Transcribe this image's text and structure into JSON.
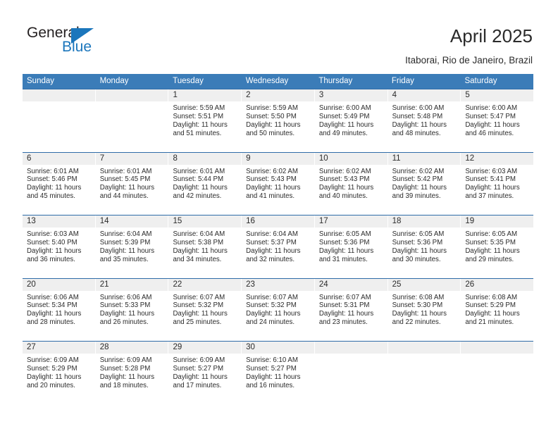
{
  "logo": {
    "word_top": "General",
    "word_bottom": "Blue",
    "accent_color": "#1b76bc"
  },
  "header": {
    "title": "April 2025",
    "location": "Itaborai, Rio de Janeiro, Brazil"
  },
  "theme": {
    "header_blue": "#3b7cb8",
    "row_divider": "#2f6ca8",
    "daynum_band": "#efefef",
    "text": "#2b2b2b"
  },
  "calendar": {
    "weekday_headers": [
      "Sunday",
      "Monday",
      "Tuesday",
      "Wednesday",
      "Thursday",
      "Friday",
      "Saturday"
    ],
    "weeks": [
      [
        {
          "day": "",
          "sunrise": "",
          "sunset": "",
          "daylight_line1": "",
          "daylight_line2": ""
        },
        {
          "day": "",
          "sunrise": "",
          "sunset": "",
          "daylight_line1": "",
          "daylight_line2": ""
        },
        {
          "day": "1",
          "sunrise": "Sunrise: 5:59 AM",
          "sunset": "Sunset: 5:51 PM",
          "daylight_line1": "Daylight: 11 hours",
          "daylight_line2": "and 51 minutes."
        },
        {
          "day": "2",
          "sunrise": "Sunrise: 5:59 AM",
          "sunset": "Sunset: 5:50 PM",
          "daylight_line1": "Daylight: 11 hours",
          "daylight_line2": "and 50 minutes."
        },
        {
          "day": "3",
          "sunrise": "Sunrise: 6:00 AM",
          "sunset": "Sunset: 5:49 PM",
          "daylight_line1": "Daylight: 11 hours",
          "daylight_line2": "and 49 minutes."
        },
        {
          "day": "4",
          "sunrise": "Sunrise: 6:00 AM",
          "sunset": "Sunset: 5:48 PM",
          "daylight_line1": "Daylight: 11 hours",
          "daylight_line2": "and 48 minutes."
        },
        {
          "day": "5",
          "sunrise": "Sunrise: 6:00 AM",
          "sunset": "Sunset: 5:47 PM",
          "daylight_line1": "Daylight: 11 hours",
          "daylight_line2": "and 46 minutes."
        }
      ],
      [
        {
          "day": "6",
          "sunrise": "Sunrise: 6:01 AM",
          "sunset": "Sunset: 5:46 PM",
          "daylight_line1": "Daylight: 11 hours",
          "daylight_line2": "and 45 minutes."
        },
        {
          "day": "7",
          "sunrise": "Sunrise: 6:01 AM",
          "sunset": "Sunset: 5:45 PM",
          "daylight_line1": "Daylight: 11 hours",
          "daylight_line2": "and 44 minutes."
        },
        {
          "day": "8",
          "sunrise": "Sunrise: 6:01 AM",
          "sunset": "Sunset: 5:44 PM",
          "daylight_line1": "Daylight: 11 hours",
          "daylight_line2": "and 42 minutes."
        },
        {
          "day": "9",
          "sunrise": "Sunrise: 6:02 AM",
          "sunset": "Sunset: 5:43 PM",
          "daylight_line1": "Daylight: 11 hours",
          "daylight_line2": "and 41 minutes."
        },
        {
          "day": "10",
          "sunrise": "Sunrise: 6:02 AM",
          "sunset": "Sunset: 5:43 PM",
          "daylight_line1": "Daylight: 11 hours",
          "daylight_line2": "and 40 minutes."
        },
        {
          "day": "11",
          "sunrise": "Sunrise: 6:02 AM",
          "sunset": "Sunset: 5:42 PM",
          "daylight_line1": "Daylight: 11 hours",
          "daylight_line2": "and 39 minutes."
        },
        {
          "day": "12",
          "sunrise": "Sunrise: 6:03 AM",
          "sunset": "Sunset: 5:41 PM",
          "daylight_line1": "Daylight: 11 hours",
          "daylight_line2": "and 37 minutes."
        }
      ],
      [
        {
          "day": "13",
          "sunrise": "Sunrise: 6:03 AM",
          "sunset": "Sunset: 5:40 PM",
          "daylight_line1": "Daylight: 11 hours",
          "daylight_line2": "and 36 minutes."
        },
        {
          "day": "14",
          "sunrise": "Sunrise: 6:04 AM",
          "sunset": "Sunset: 5:39 PM",
          "daylight_line1": "Daylight: 11 hours",
          "daylight_line2": "and 35 minutes."
        },
        {
          "day": "15",
          "sunrise": "Sunrise: 6:04 AM",
          "sunset": "Sunset: 5:38 PM",
          "daylight_line1": "Daylight: 11 hours",
          "daylight_line2": "and 34 minutes."
        },
        {
          "day": "16",
          "sunrise": "Sunrise: 6:04 AM",
          "sunset": "Sunset: 5:37 PM",
          "daylight_line1": "Daylight: 11 hours",
          "daylight_line2": "and 32 minutes."
        },
        {
          "day": "17",
          "sunrise": "Sunrise: 6:05 AM",
          "sunset": "Sunset: 5:36 PM",
          "daylight_line1": "Daylight: 11 hours",
          "daylight_line2": "and 31 minutes."
        },
        {
          "day": "18",
          "sunrise": "Sunrise: 6:05 AM",
          "sunset": "Sunset: 5:36 PM",
          "daylight_line1": "Daylight: 11 hours",
          "daylight_line2": "and 30 minutes."
        },
        {
          "day": "19",
          "sunrise": "Sunrise: 6:05 AM",
          "sunset": "Sunset: 5:35 PM",
          "daylight_line1": "Daylight: 11 hours",
          "daylight_line2": "and 29 minutes."
        }
      ],
      [
        {
          "day": "20",
          "sunrise": "Sunrise: 6:06 AM",
          "sunset": "Sunset: 5:34 PM",
          "daylight_line1": "Daylight: 11 hours",
          "daylight_line2": "and 28 minutes."
        },
        {
          "day": "21",
          "sunrise": "Sunrise: 6:06 AM",
          "sunset": "Sunset: 5:33 PM",
          "daylight_line1": "Daylight: 11 hours",
          "daylight_line2": "and 26 minutes."
        },
        {
          "day": "22",
          "sunrise": "Sunrise: 6:07 AM",
          "sunset": "Sunset: 5:32 PM",
          "daylight_line1": "Daylight: 11 hours",
          "daylight_line2": "and 25 minutes."
        },
        {
          "day": "23",
          "sunrise": "Sunrise: 6:07 AM",
          "sunset": "Sunset: 5:32 PM",
          "daylight_line1": "Daylight: 11 hours",
          "daylight_line2": "and 24 minutes."
        },
        {
          "day": "24",
          "sunrise": "Sunrise: 6:07 AM",
          "sunset": "Sunset: 5:31 PM",
          "daylight_line1": "Daylight: 11 hours",
          "daylight_line2": "and 23 minutes."
        },
        {
          "day": "25",
          "sunrise": "Sunrise: 6:08 AM",
          "sunset": "Sunset: 5:30 PM",
          "daylight_line1": "Daylight: 11 hours",
          "daylight_line2": "and 22 minutes."
        },
        {
          "day": "26",
          "sunrise": "Sunrise: 6:08 AM",
          "sunset": "Sunset: 5:29 PM",
          "daylight_line1": "Daylight: 11 hours",
          "daylight_line2": "and 21 minutes."
        }
      ],
      [
        {
          "day": "27",
          "sunrise": "Sunrise: 6:09 AM",
          "sunset": "Sunset: 5:29 PM",
          "daylight_line1": "Daylight: 11 hours",
          "daylight_line2": "and 20 minutes."
        },
        {
          "day": "28",
          "sunrise": "Sunrise: 6:09 AM",
          "sunset": "Sunset: 5:28 PM",
          "daylight_line1": "Daylight: 11 hours",
          "daylight_line2": "and 18 minutes."
        },
        {
          "day": "29",
          "sunrise": "Sunrise: 6:09 AM",
          "sunset": "Sunset: 5:27 PM",
          "daylight_line1": "Daylight: 11 hours",
          "daylight_line2": "and 17 minutes."
        },
        {
          "day": "30",
          "sunrise": "Sunrise: 6:10 AM",
          "sunset": "Sunset: 5:27 PM",
          "daylight_line1": "Daylight: 11 hours",
          "daylight_line2": "and 16 minutes."
        },
        {
          "day": "",
          "sunrise": "",
          "sunset": "",
          "daylight_line1": "",
          "daylight_line2": ""
        },
        {
          "day": "",
          "sunrise": "",
          "sunset": "",
          "daylight_line1": "",
          "daylight_line2": ""
        },
        {
          "day": "",
          "sunrise": "",
          "sunset": "",
          "daylight_line1": "",
          "daylight_line2": ""
        }
      ]
    ]
  }
}
